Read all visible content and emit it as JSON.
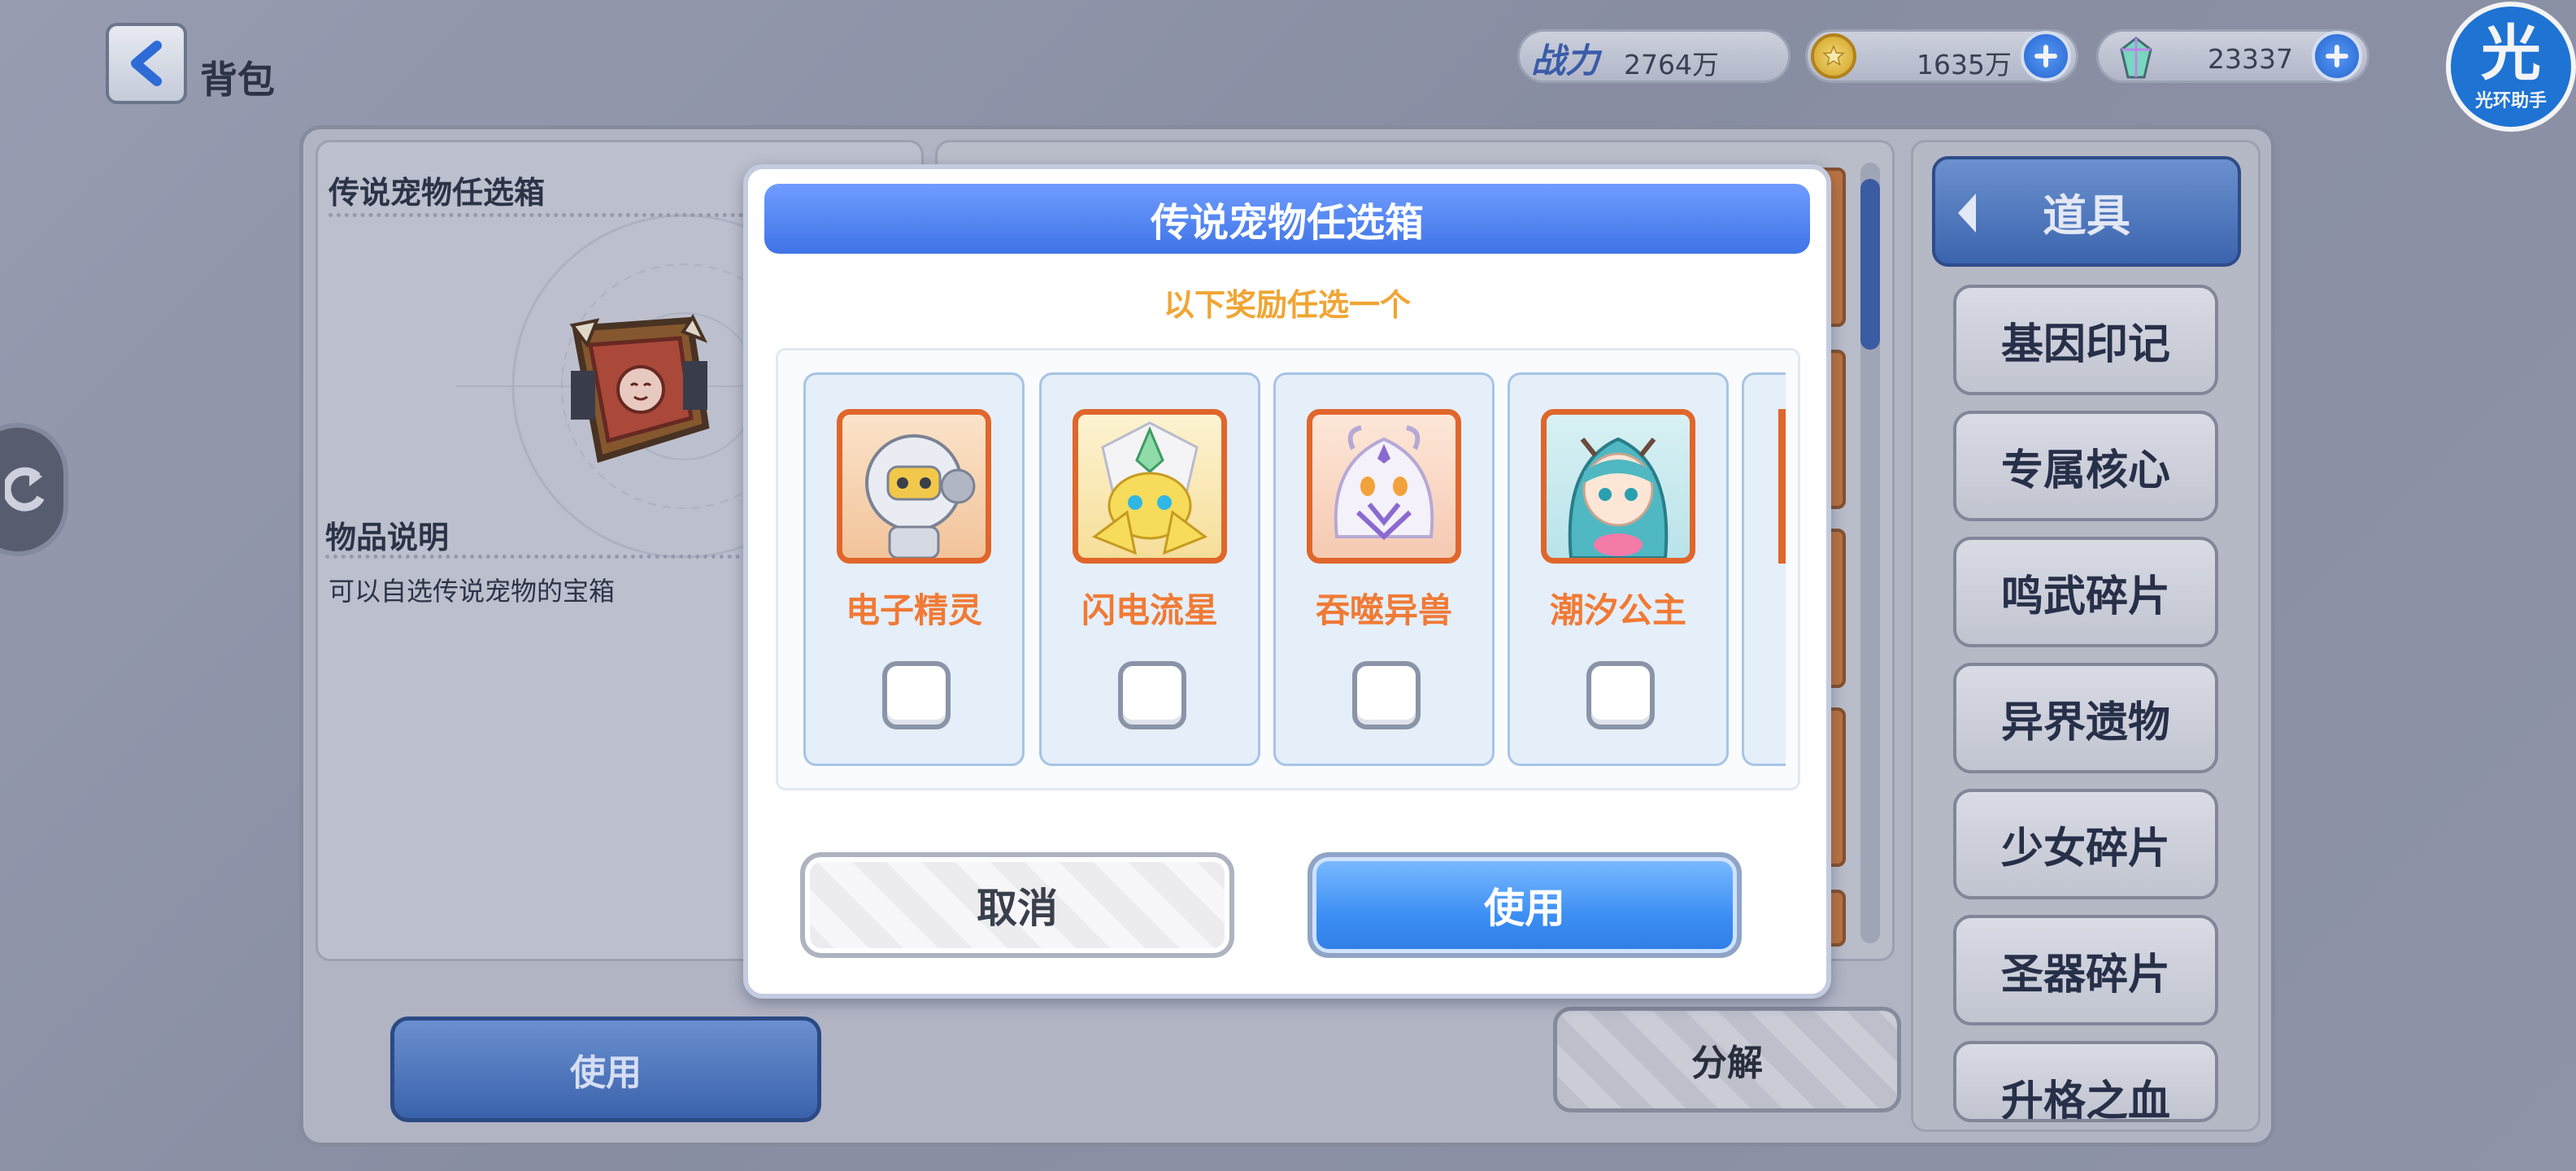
{
  "top_bar": {
    "title": "背包",
    "power_icon_label": "战力",
    "power_value": "2764万",
    "coins_value": "1635万",
    "gems_value": "23337",
    "assistant_logo_char": "光",
    "assistant_logo_text": "光环助手"
  },
  "item_detail": {
    "item_name": "传说宠物任选箱",
    "desc_heading": "物品说明",
    "desc_text": "可以自选传说宠物的宝箱"
  },
  "background_buttons": {
    "use_label": "使用",
    "decompose_label": "分解"
  },
  "sidebar": {
    "active_tab": "道具",
    "tabs": [
      "基因印记",
      "专属核心",
      "鸣武碎片",
      "异界遗物",
      "少女碎片",
      "圣器碎片",
      "升格之血"
    ]
  },
  "dialog": {
    "title": "传说宠物任选箱",
    "subtitle": "以下奖励任选一个",
    "rewards": [
      {
        "name": "电子精灵",
        "checked": false
      },
      {
        "name": "闪电流星",
        "checked": false
      },
      {
        "name": "吞噬异兽",
        "checked": false
      },
      {
        "name": "潮汐公主",
        "checked": false
      }
    ],
    "cancel_label": "取消",
    "use_label": "使用"
  },
  "colors": {
    "accent_blue": "#3f74e6",
    "reward_name_orange": "#f07a35",
    "subtitle_gold": "#f0a533",
    "avatar_border": "#e0662b"
  }
}
